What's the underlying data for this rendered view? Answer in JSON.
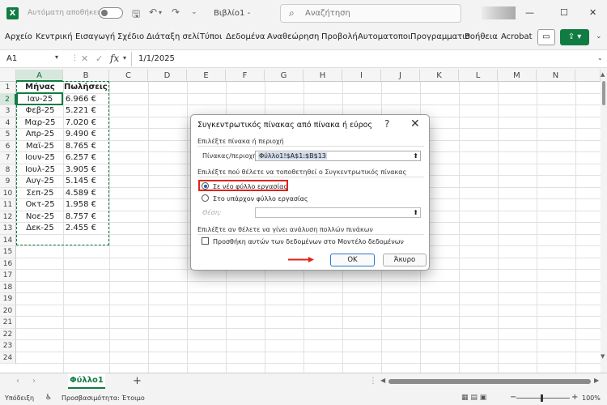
{
  "titlebar": {
    "autosave_label": "Αυτόματη αποθήκευση",
    "filename": "Βιβλίο1 -",
    "search_placeholder": "Αναζήτηση",
    "app_logo": "X"
  },
  "ribbon": {
    "tabs": [
      "Αρχείο",
      "Κεντρική",
      "Εισαγωγή",
      "Σχέδιο",
      "Διάταξη σελί",
      "Τύποι",
      "Δεδομένα",
      "Αναθεώρηση",
      "Προβολή",
      "Αυτοματοποι",
      "Προγραμματισ",
      "Βοήθεια",
      "Acrobat"
    ]
  },
  "formula_bar": {
    "name_box": "A1",
    "fx": "fx",
    "content": "1/1/2025"
  },
  "grid": {
    "columns": [
      "A",
      "B",
      "C",
      "D",
      "E",
      "F",
      "G",
      "H",
      "I",
      "J",
      "K",
      "L",
      "M",
      "N"
    ],
    "rows": [
      "1",
      "2",
      "3",
      "4",
      "5",
      "6",
      "7",
      "8",
      "9",
      "10",
      "11",
      "12",
      "13",
      "14",
      "15",
      "16",
      "17",
      "18",
      "19",
      "20",
      "21",
      "22",
      "23",
      "24"
    ],
    "header": {
      "a": "Μήνας",
      "b": "Πωλήσεις"
    },
    "data": [
      {
        "a": "Ιαν-25",
        "b": "6.966 €"
      },
      {
        "a": "Φεβ-25",
        "b": "5.221 €"
      },
      {
        "a": "Μαρ-25",
        "b": "7.020 €"
      },
      {
        "a": "Απρ-25",
        "b": "9.490 €"
      },
      {
        "a": "Μαϊ-25",
        "b": "8.765 €"
      },
      {
        "a": "Ιουν-25",
        "b": "6.257 €"
      },
      {
        "a": "Ιουλ-25",
        "b": "3.905 €"
      },
      {
        "a": "Αυγ-25",
        "b": "5.145 €"
      },
      {
        "a": "Σεπ-25",
        "b": "4.589 €"
      },
      {
        "a": "Οκτ-25",
        "b": "1.958 €"
      },
      {
        "a": "Νοε-25",
        "b": "8.757 €"
      },
      {
        "a": "Δεκ-25",
        "b": "2.455 €"
      }
    ]
  },
  "sheets": {
    "active": "Φύλλο1"
  },
  "statusbar": {
    "ready": "Υπόδειξη",
    "accessibility": "Προσβασιμότητα: Έτοιμο",
    "zoom": "100%"
  },
  "dialog": {
    "title": "Συγκεντρωτικός πίνακας από πίνακα ή εύρος",
    "section1": "Επιλέξτε πίνακα ή περιοχή",
    "range_label": "Πίνακας/περιοχή:",
    "range_value": "Φύλλο1!$A$1:$B$13",
    "section2": "Επιλέξτε πού θέλετε να τοποθετηθεί ο Συγκεντρωτικός πίνακας",
    "option_new": "Σε νέο φύλλο εργασίας",
    "option_existing": "Στο υπάρχον φύλλο εργασίας",
    "location_label": "Θέση:",
    "section3": "Επιλέξτε αν θέλετε να γίνει ανάλυση πολλών πινάκων",
    "checkbox_label": "Προσθήκη αυτών των δεδομένων στο Μοντέλο δεδομένων",
    "ok": "OK",
    "cancel": "Άκυρο",
    "selected_option": "option_new",
    "highlight_color": "#e2231a"
  },
  "colors": {
    "accent": "#107c41"
  }
}
